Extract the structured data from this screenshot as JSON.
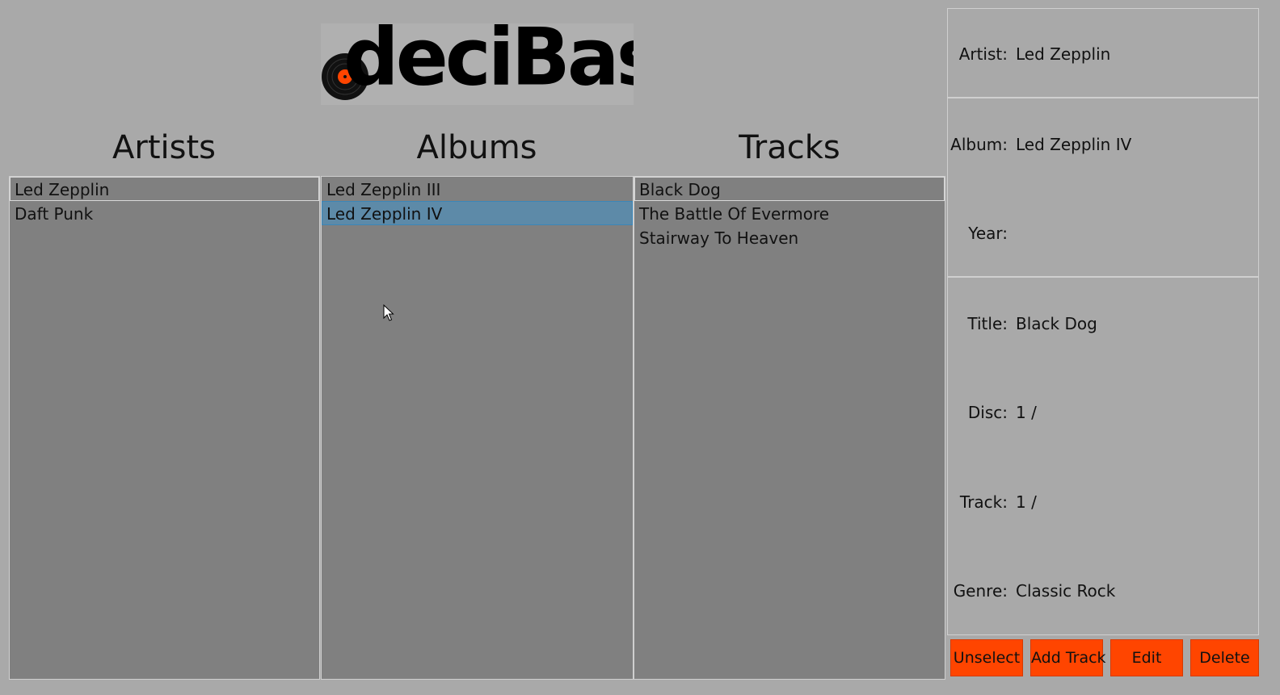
{
  "app": {
    "logo_text": "deciBase"
  },
  "columns": {
    "artists": {
      "heading": "Artists",
      "items": [
        "Led Zepplin",
        "Daft Punk"
      ]
    },
    "albums": {
      "heading": "Albums",
      "items": [
        "Led Zepplin III",
        "Led Zepplin IV"
      ]
    },
    "tracks": {
      "heading": "Tracks",
      "items": [
        "Black Dog",
        "The Battle Of Evermore",
        "Stairway To Heaven"
      ]
    }
  },
  "details": {
    "artist": {
      "label": "Artist:",
      "value": "Led Zepplin"
    },
    "album": {
      "label": "Album:",
      "value": "Led Zepplin IV"
    },
    "year": {
      "label": "Year:",
      "value": ""
    },
    "title": {
      "label": "Title:",
      "value": "Black Dog"
    },
    "disc": {
      "label": "Disc:",
      "value": "1 /"
    },
    "track": {
      "label": "Track:",
      "value": "1 /"
    },
    "genre": {
      "label": "Genre:",
      "value": "Classic Rock"
    }
  },
  "buttons": {
    "unselect": "Unselect",
    "add_track": "Add Track",
    "edit": "Edit",
    "delete": "Delete"
  },
  "colors": {
    "background": "#a9a9a9",
    "list_background": "#808080",
    "accent_button": "#ff4500",
    "selection": "#5d8aa8"
  }
}
